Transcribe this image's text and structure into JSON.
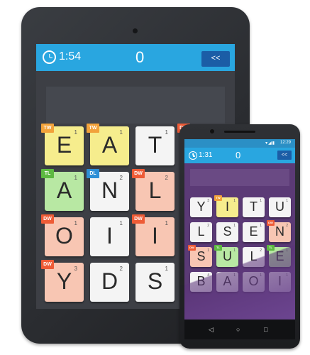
{
  "tablet": {
    "timer": "1:54",
    "score": "0",
    "back_label": "<<",
    "tiles": [
      {
        "letter": "E",
        "points": "1",
        "color": "c-yellow",
        "badge": "TW",
        "badge_color": "b-orange"
      },
      {
        "letter": "A",
        "points": "1",
        "color": "c-yellow",
        "badge": "TW",
        "badge_color": "b-orange"
      },
      {
        "letter": "T",
        "points": "1",
        "color": "c-white",
        "badge": "",
        "badge_color": ""
      },
      {
        "letter": "",
        "points": "",
        "color": "c-pink",
        "badge": "DW",
        "badge_color": "b-red"
      },
      {
        "letter": "A",
        "points": "1",
        "color": "c-green",
        "badge": "TL",
        "badge_color": "b-green"
      },
      {
        "letter": "N",
        "points": "2",
        "color": "c-white",
        "badge": "DL",
        "badge_color": "b-blue"
      },
      {
        "letter": "L",
        "points": "2",
        "color": "c-pink",
        "badge": "DW",
        "badge_color": "b-red"
      },
      {
        "letter": "",
        "points": "",
        "color": "c-yellow",
        "badge": "",
        "badge_color": ""
      },
      {
        "letter": "O",
        "points": "1",
        "color": "c-pink",
        "badge": "DW",
        "badge_color": "b-red"
      },
      {
        "letter": "I",
        "points": "1",
        "color": "c-white",
        "badge": "",
        "badge_color": ""
      },
      {
        "letter": "I",
        "points": "1",
        "color": "c-pink",
        "badge": "DW",
        "badge_color": "b-red"
      },
      {
        "letter": "",
        "points": "",
        "color": "c-white",
        "badge": "",
        "badge_color": ""
      },
      {
        "letter": "Y",
        "points": "3",
        "color": "c-pink",
        "badge": "DW",
        "badge_color": "b-red"
      },
      {
        "letter": "D",
        "points": "2",
        "color": "c-white",
        "badge": "",
        "badge_color": ""
      },
      {
        "letter": "S",
        "points": "1",
        "color": "c-white",
        "badge": "",
        "badge_color": ""
      },
      {
        "letter": "",
        "points": "",
        "color": "c-blue",
        "badge": "",
        "badge_color": ""
      }
    ]
  },
  "phone": {
    "status_time": "12:29",
    "timer": "1:31",
    "score": "0",
    "back_label": "<<",
    "tiles": [
      {
        "letter": "Y",
        "points": "3",
        "color": "c-white",
        "badge": "",
        "badge_color": ""
      },
      {
        "letter": "I",
        "points": "1",
        "color": "c-yellow",
        "badge": "TW",
        "badge_color": "b-orange"
      },
      {
        "letter": "T",
        "points": "1",
        "color": "c-white",
        "badge": "",
        "badge_color": ""
      },
      {
        "letter": "U",
        "points": "1",
        "color": "c-white",
        "badge": "",
        "badge_color": ""
      },
      {
        "letter": "L",
        "points": "2",
        "color": "c-white",
        "badge": "",
        "badge_color": ""
      },
      {
        "letter": "S",
        "points": "1",
        "color": "c-white",
        "badge": "",
        "badge_color": ""
      },
      {
        "letter": "E",
        "points": "1",
        "color": "c-white",
        "badge": "",
        "badge_color": ""
      },
      {
        "letter": "N",
        "points": "2",
        "color": "c-pink",
        "badge": "DW",
        "badge_color": "b-red"
      },
      {
        "letter": "S",
        "points": "1",
        "color": "c-pink",
        "badge": "DW",
        "badge_color": "b-red"
      },
      {
        "letter": "U",
        "points": "1",
        "color": "c-green",
        "badge": "TL",
        "badge_color": "b-green"
      },
      {
        "letter": "L",
        "points": "2",
        "color": "c-white",
        "badge": "",
        "badge_color": ""
      },
      {
        "letter": "E",
        "points": "1",
        "color": "c-green",
        "badge": "TL",
        "badge_color": "b-green"
      },
      {
        "letter": "B",
        "points": "4",
        "color": "c-white",
        "badge": "",
        "badge_color": ""
      },
      {
        "letter": "A",
        "points": "1",
        "color": "c-white",
        "badge": "",
        "badge_color": ""
      },
      {
        "letter": "O",
        "points": "1",
        "color": "c-white",
        "badge": "",
        "badge_color": ""
      },
      {
        "letter": "I",
        "points": "1",
        "color": "c-white",
        "badge": "",
        "badge_color": ""
      }
    ]
  },
  "icons": {
    "clock": "clock-icon",
    "back": "back-icon",
    "nav_back": "◁",
    "nav_home": "○",
    "nav_recent": "□"
  }
}
